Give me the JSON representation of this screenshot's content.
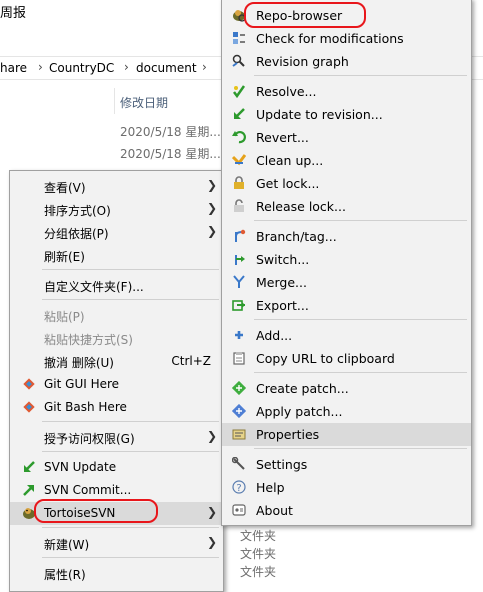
{
  "explorer": {
    "title_fragment": "周报",
    "breadcrumb": [
      "hare",
      "CountryDC",
      "document"
    ],
    "column_header": "修改日期",
    "dates": [
      "2020/5/18 星期...",
      "2020/5/18 星期..."
    ],
    "type_cells": [
      "文件夹",
      "文件夹",
      "文件夹"
    ]
  },
  "context_menu": {
    "view": "查看(V)",
    "sort_by": "排序方式(O)",
    "group_by": "分组依据(P)",
    "refresh": "刷新(E)",
    "customize_folder": "自定义文件夹(F)...",
    "paste": "粘贴(P)",
    "paste_shortcut": "粘贴快捷方式(S)",
    "undo_delete": "撤消 删除(U)",
    "undo_shortcut": "Ctrl+Z",
    "git_gui": "Git GUI Here",
    "git_bash": "Git Bash Here",
    "grant_access": "授予访问权限(G)",
    "svn_update": "SVN Update",
    "svn_commit": "SVN Commit...",
    "tortoise_svn": "TortoiseSVN",
    "new": "新建(W)",
    "properties": "属性(R)"
  },
  "tortoise_menu": {
    "repo_browser": "Repo-browser",
    "check_modifications": "Check for modifications",
    "revision_graph": "Revision graph",
    "resolve": "Resolve...",
    "update_to_revision": "Update to revision...",
    "revert": "Revert...",
    "clean_up": "Clean up...",
    "get_lock": "Get lock...",
    "release_lock": "Release lock...",
    "branch_tag": "Branch/tag...",
    "switch": "Switch...",
    "merge": "Merge...",
    "export": "Export...",
    "add": "Add...",
    "copy_url": "Copy URL to clipboard",
    "create_patch": "Create patch...",
    "apply_patch": "Apply patch...",
    "properties": "Properties",
    "settings": "Settings",
    "help": "Help",
    "about": "About"
  },
  "colors": {
    "menu_bg": "#f2f2f2",
    "highlight": "#dadada",
    "annotation": "#e8161b"
  }
}
